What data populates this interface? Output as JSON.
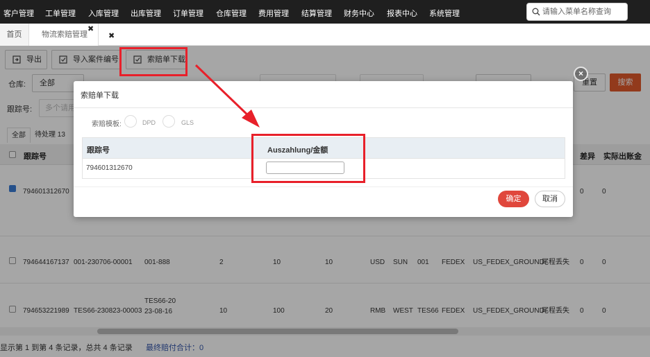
{
  "nav": {
    "items": [
      "客户管理",
      "工单管理",
      "入库管理",
      "出库管理",
      "订单管理",
      "仓库管理",
      "费用管理",
      "结算管理",
      "财务中心",
      "报表中心",
      "系统管理"
    ],
    "search_placeholder": "请输入菜单名称查询"
  },
  "tabs": {
    "home": "首页",
    "active": "物流索赔管理",
    "close_glyph": "✖",
    "extra_close_glyph": "✖"
  },
  "toolbar": {
    "export": "导出",
    "import_case": "导入案件编号",
    "claim_download": "索赔单下载"
  },
  "filters": {
    "warehouse_label": "仓库:",
    "warehouse_value": "全部",
    "tracking_label": "跟踪号:",
    "tracking_placeholder": "多个请用",
    "reset": "重置",
    "search": "搜索"
  },
  "subtabs": {
    "all": "全部",
    "pending": "待处理 13"
  },
  "grid": {
    "headers": {
      "tracking": "跟踪号",
      "diff": "差异",
      "actual_out": "实际出账金"
    },
    "rows": [
      {
        "checked": true,
        "tracking": "794601312670",
        "c2": "",
        "c3": "",
        "c4": "",
        "c5": "",
        "c6": "",
        "cur": "",
        "c8": "",
        "c9": "",
        "carrier": "",
        "service": "",
        "reason": "",
        "diff": "0",
        "actual": "0"
      },
      {
        "checked": false,
        "tracking": "794644167137",
        "c2": "001-230706-00001",
        "c3": "001-888",
        "c4": "2",
        "c5": "10",
        "c6": "10",
        "cur": "USD",
        "c8": "SUN",
        "c9": "001",
        "carrier": "FEDEX",
        "service": "US_FEDEX_GROUND",
        "reason": "尾程丢失",
        "diff": "0",
        "actual": "0"
      },
      {
        "checked": false,
        "tracking": "794653221989",
        "c2": "TES66-230823-00003",
        "c3": "TES66-20\n23-08-16",
        "c4": "10",
        "c5": "100",
        "c6": "20",
        "cur": "RMB",
        "c8": "WEST",
        "c9": "TES66",
        "carrier": "FEDEX",
        "service": "US_FEDEX_GROUND",
        "reason": "尾程丢失",
        "diff": "0",
        "actual": "0"
      }
    ]
  },
  "footer": {
    "records": "显示第 1 到第 4 条记录，总共 4 条记录",
    "total": "最终赔付合计：0"
  },
  "modal": {
    "title": "索赔单下载",
    "template_label": "索赔模板:",
    "template_options": [
      "DPD",
      "GLS"
    ],
    "col_tracking": "跟踪号",
    "col_amount": "Auszahlung/金额",
    "row_tracking": "794601312670",
    "amount_value": "",
    "confirm": "确定",
    "cancel": "取消",
    "close_glyph": "×"
  },
  "colors": {
    "nav_bg": "#1f1f1f",
    "accent": "#e0592b",
    "confirm": "#e0473c",
    "annotation": "#e8202a"
  }
}
